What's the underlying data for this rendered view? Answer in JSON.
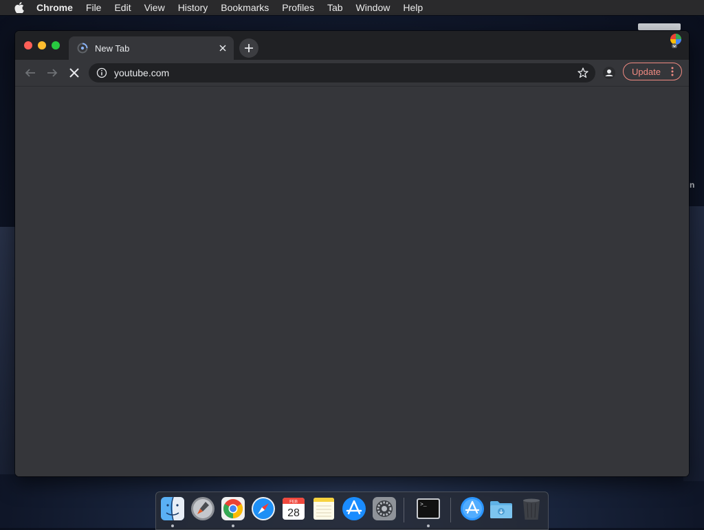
{
  "menubar": {
    "app_name": "Chrome",
    "items": [
      "File",
      "Edit",
      "View",
      "History",
      "Bookmarks",
      "Profiles",
      "Tab",
      "Window",
      "Help"
    ]
  },
  "desktop": {
    "stray_text": "n"
  },
  "browser": {
    "tab": {
      "title": "New Tab"
    },
    "omnibox": {
      "url": "youtube.com"
    },
    "update_label": "Update",
    "colors": {
      "accent_update": "#f28b82",
      "background": "#35363a",
      "tabstrip": "#202124"
    }
  },
  "dock": {
    "calendar": {
      "month": "FEB",
      "day": "28"
    },
    "terminal_prompt": ">_",
    "items": [
      "finder",
      "launchpad",
      "chrome",
      "safari",
      "calendar",
      "notes",
      "app-store",
      "system-preferences",
      "terminal",
      "applications-folder",
      "downloads-folder",
      "trash"
    ]
  }
}
